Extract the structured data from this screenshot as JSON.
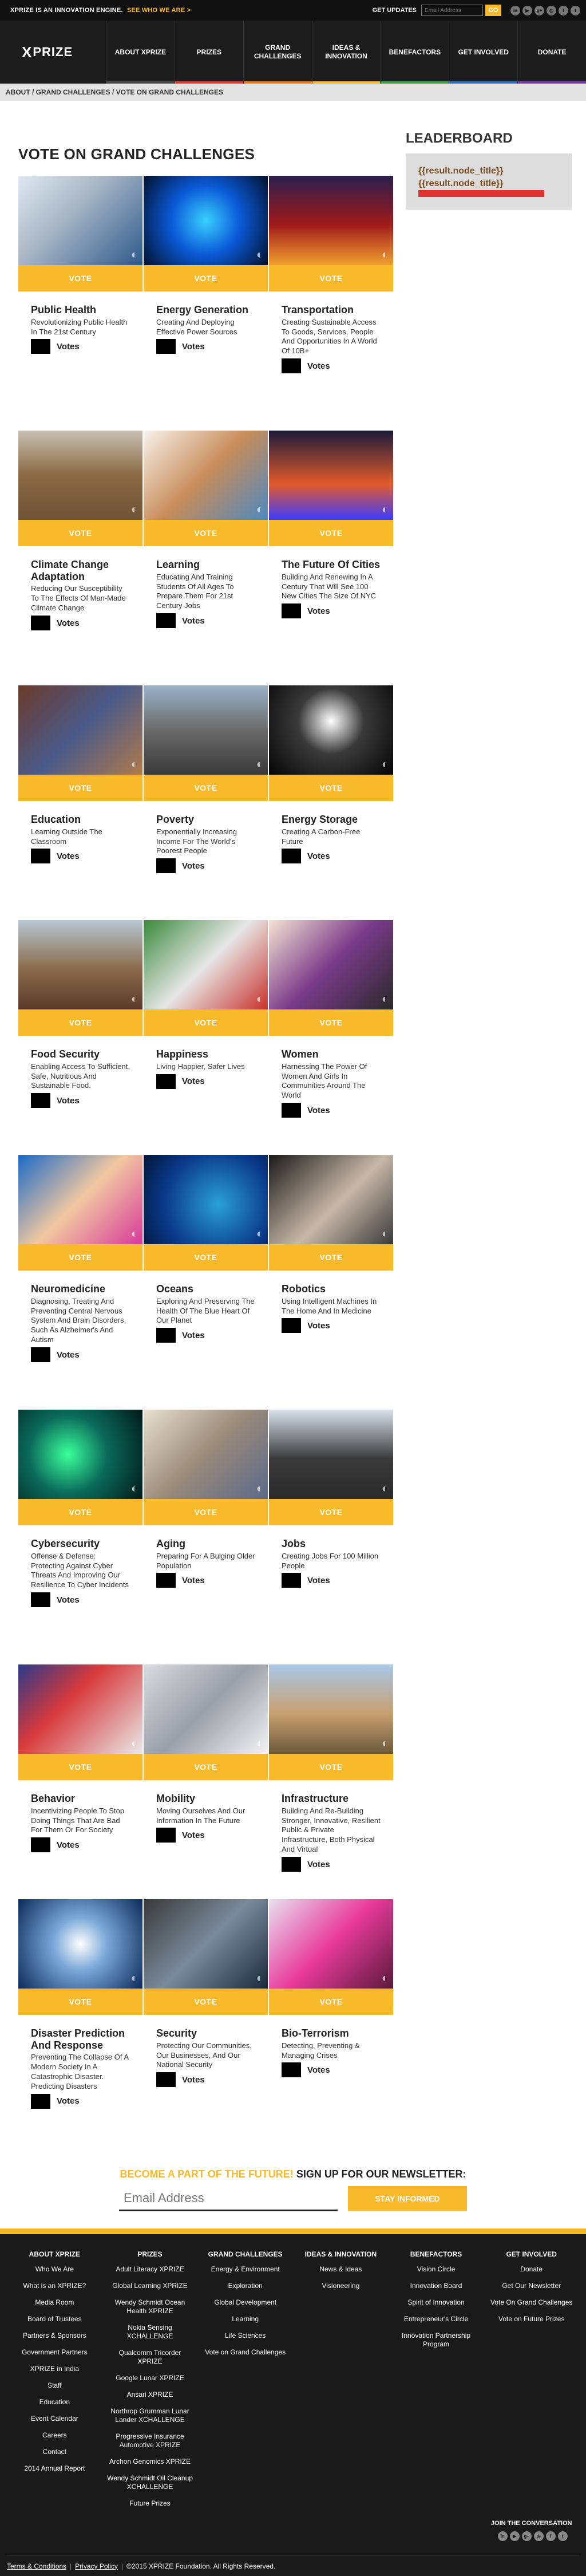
{
  "topbar": {
    "tagline": "XPRIZE IS AN INNOVATION ENGINE.",
    "tagline_link": "SEE WHO WE ARE >",
    "get_updates": "GET UPDATES",
    "email_placeholder": "Email Address",
    "go_label": "GO",
    "social_icons": [
      "linkedin-icon",
      "youtube-icon",
      "googleplus-icon",
      "instagram-icon",
      "facebook-icon",
      "twitter-icon"
    ]
  },
  "nav": {
    "logo": "PRIZE",
    "logo_x": "X",
    "items": [
      {
        "label": "ABOUT XPRIZE",
        "color": "#4a4a4a"
      },
      {
        "label": "PRIZES",
        "color": "#e33b2e"
      },
      {
        "label": "GRAND CHALLENGES",
        "color": "#f07b1d"
      },
      {
        "label": "IDEAS & INNOVATION",
        "color": "#f8b92a"
      },
      {
        "label": "BENEFACTORS",
        "color": "#3aa040"
      },
      {
        "label": "GET INVOLVED",
        "color": "#2d6fc7"
      },
      {
        "label": "DONATE",
        "color": "#7b3aa8"
      }
    ]
  },
  "breadcrumb": "ABOUT / GRAND CHALLENGES / VOTE ON GRAND CHALLENGES",
  "page_title": "VOTE ON GRAND CHALLENGES",
  "vote_label": "VOTE",
  "votes_label": "Votes",
  "cards": [
    {
      "title": "Public Health",
      "desc": "Revolutionizing Public Health In The 21st Century"
    },
    {
      "title": "Energy Generation",
      "desc": "Creating And Deploying Effective Power Sources"
    },
    {
      "title": "Transportation",
      "desc": "Creating Sustainable Access To Goods, Services, People And Opportunities In A World Of 10B+"
    },
    {
      "title": "Climate Change Adaptation",
      "desc": "Reducing Our Susceptibility To The Effects Of Man-Made Climate Change"
    },
    {
      "title": "Learning",
      "desc": "Educating And Training Students Of All Ages To Prepare Them For 21st Century Jobs"
    },
    {
      "title": "The Future Of Cities",
      "desc": "Building And Renewing In A Century That Will See 100 New Cities The Size Of NYC"
    },
    {
      "title": "Education",
      "desc": "Learning Outside The Classroom"
    },
    {
      "title": "Poverty",
      "desc": "Exponentially Increasing Income For The World's Poorest People"
    },
    {
      "title": "Energy Storage",
      "desc": "Creating A Carbon-Free Future"
    },
    {
      "title": "Food Security",
      "desc": "Enabling Access To Sufficient, Safe, Nutritious And Sustainable Food."
    },
    {
      "title": "Happiness",
      "desc": "Living Happier, Safer Lives"
    },
    {
      "title": "Women",
      "desc": "Harnessing The Power Of Women And Girls In Communities Around The World"
    },
    {
      "title": "Neuromedicine",
      "desc": "Diagnosing, Treating And Preventing Central Nervous System And Brain Disorders, Such As Alzheimer's And Autism"
    },
    {
      "title": "Oceans",
      "desc": "Exploring And Preserving The Health Of The Blue Heart Of Our Planet"
    },
    {
      "title": "Robotics",
      "desc": "Using Intelligent Machines In The Home And In Medicine"
    },
    {
      "title": "Cybersecurity",
      "desc": "Offense & Defense: Protecting Against Cyber Threats And Improving Our Resilience To Cyber Incidents"
    },
    {
      "title": "Aging",
      "desc": "Preparing For A Bulging Older Population"
    },
    {
      "title": "Jobs",
      "desc": "Creating Jobs For 100 Million People"
    },
    {
      "title": "Behavior",
      "desc": "Incentivizing People To Stop Doing Things That Are Bad For Them Or For Society"
    },
    {
      "title": "Mobility",
      "desc": "Moving Ourselves And Our Information In The Future"
    },
    {
      "title": "Infrastructure",
      "desc": "Building And Re-Building Stronger, Innovative, Resilient Public & Private Infrastructure, Both Physical And Virtual"
    },
    {
      "title": "Disaster Prediction And Response",
      "desc": "Preventing The Collapse Of A Modern Society In A Catastrophic Disaster. Predicting Disasters"
    },
    {
      "title": "Security",
      "desc": "Protecting Our Communities, Our Businesses, And Our National Security"
    },
    {
      "title": "Bio-Terrorism",
      "desc": "Detecting, Preventing & Managing Crises"
    }
  ],
  "leaderboard": {
    "title": "LEADERBOARD",
    "items": [
      "{{result.node_title}}",
      "{{result.node_title}}"
    ]
  },
  "newsletter": {
    "heading_accent": "BECOME A PART OF THE FUTURE!",
    "heading": "SIGN UP FOR OUR NEWSLETTER:",
    "placeholder": "Email Address",
    "button": "STAY INFORMED"
  },
  "footer": {
    "columns": [
      {
        "heading": "ABOUT XPRIZE",
        "links": [
          "Who We Are",
          "What is an XPRIZE?",
          "Media Room",
          "Board of Trustees",
          "Partners & Sponsors",
          "Government Partners",
          "XPRIZE in India",
          "Staff",
          "Education",
          "Event Calendar",
          "Careers",
          "Contact",
          "2014 Annual Report"
        ]
      },
      {
        "heading": "PRIZES",
        "links": [
          "Adult Literacy XPRIZE",
          "Global Learning XPRIZE",
          "Wendy Schmidt Ocean Health XPRIZE",
          "Nokia Sensing XCHALLENGE",
          "Qualcomm Tricorder XPRIZE",
          "Google Lunar XPRIZE",
          "Ansari XPRIZE",
          "Northrop Grumman Lunar Lander XCHALLENGE",
          "Progressive Insurance Automotive XPRIZE",
          "Archon Genomics XPRIZE",
          "Wendy Schmidt Oil Cleanup XCHALLENGE",
          "Future Prizes"
        ]
      },
      {
        "heading": "GRAND CHALLENGES",
        "links": [
          "Energy & Environment",
          "Exploration",
          "Global Development",
          "Learning",
          "Life Sciences",
          "Vote on Grand Challenges"
        ]
      },
      {
        "heading": "IDEAS & INNOVATION",
        "links": [
          "News & Ideas",
          "Visioneering"
        ]
      },
      {
        "heading": "BENEFACTORS",
        "links": [
          "Vision Circle",
          "Innovation Board",
          "Spirit of Innovation",
          "Entrepreneur's Circle",
          "Innovation Partnership Program"
        ]
      },
      {
        "heading": "GET INVOLVED",
        "links": [
          "Donate",
          "Get Our Newsletter",
          "Vote On Grand Challenges",
          "Vote on Future Prizes"
        ]
      }
    ],
    "join": "JOIN THE CONVERSATION",
    "terms": "Terms & Conditions",
    "privacy": "Privacy Policy",
    "copyright": "©2015 XPRIZE Foundation. All Rights Reserved."
  }
}
